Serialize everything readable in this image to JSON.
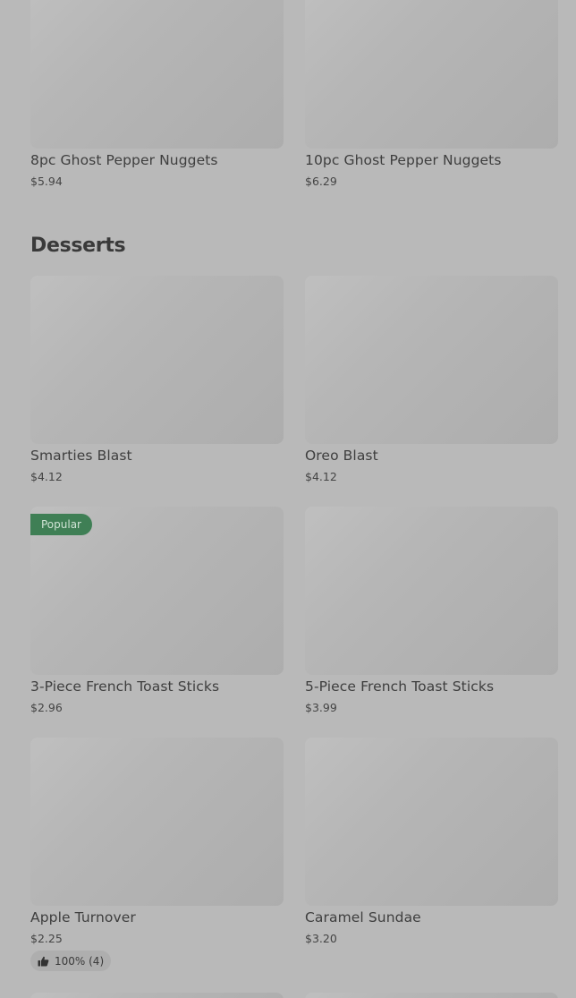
{
  "sections": [
    {
      "items": [
        {
          "name": "8pc Ghost Pepper Nuggets",
          "price": "$5.94"
        },
        {
          "name": "10pc Ghost Pepper Nuggets",
          "price": "$6.29"
        }
      ]
    },
    {
      "title": "Desserts",
      "items": [
        {
          "name": "Smarties Blast",
          "price": "$4.12"
        },
        {
          "name": "Oreo Blast",
          "price": "$4.12"
        },
        {
          "name": "3-Piece French Toast Sticks",
          "price": "$2.96",
          "badge": "Popular"
        },
        {
          "name": "5-Piece French Toast Sticks",
          "price": "$3.99"
        },
        {
          "name": "Apple Turnover",
          "price": "$2.25",
          "rating": "100% (4)",
          "rating_icon": "thumbs-up-icon"
        },
        {
          "name": "Caramel Sundae",
          "price": "$3.20"
        }
      ]
    }
  ],
  "colors": {
    "overlay_background": "#b9b9b9",
    "badge_background": "#3f7f55",
    "rating_background": "#aeaeae"
  }
}
